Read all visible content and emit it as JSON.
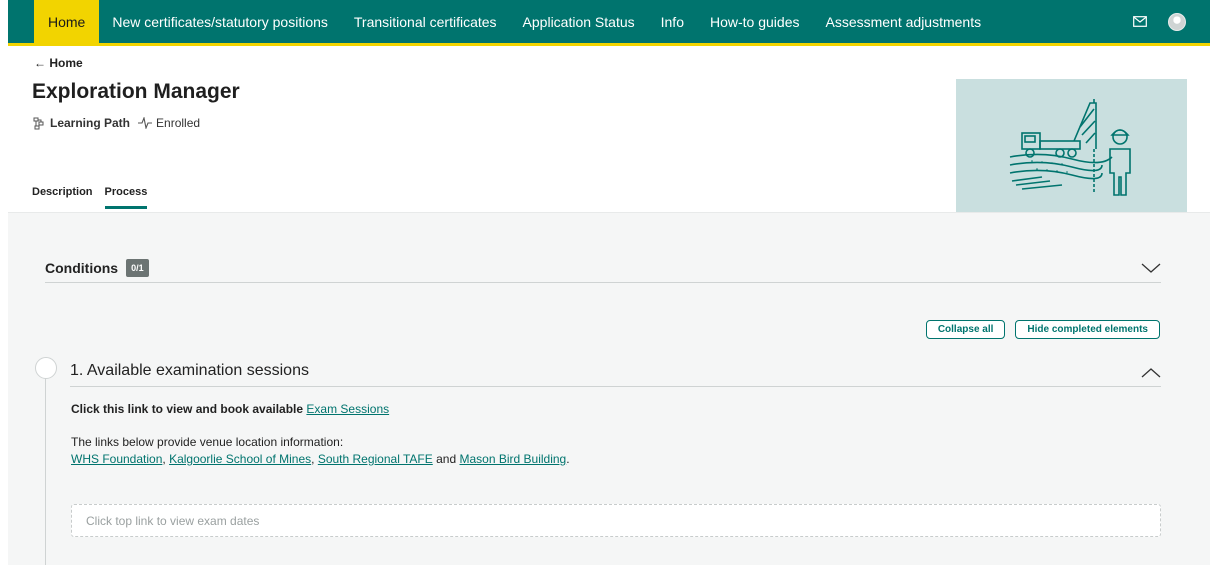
{
  "nav": {
    "items": [
      "Home",
      "New certificates/statutory positions",
      "Transitional certificates",
      "Application Status",
      "Info",
      "How-to guides",
      "Assessment adjustments"
    ]
  },
  "header": {
    "back_label": "← Home",
    "title": "Exploration Manager",
    "type_label": "Learning Path",
    "status_label": "Enrolled",
    "tabs": [
      "Description",
      "Process"
    ]
  },
  "conditions": {
    "title": "Conditions",
    "badge": "0/1"
  },
  "actions": {
    "collapse_label": "Collapse all",
    "hide_label": "Hide completed elements"
  },
  "step": {
    "title": "1. Available examination sessions",
    "link_prefix": "Click this link to view and book available",
    "link_text": "Exam Sessions",
    "intro": "The links below provide venue location information:",
    "venues": [
      "WHS Foundation",
      "Kalgoorlie School of Mines",
      "South Regional TAFE",
      "Mason Bird Building"
    ],
    "placeholder": "Click top link to view exam dates"
  },
  "colors": {
    "brand": "#00746e",
    "accent": "#f2d400"
  },
  "icons": {
    "mail": "mail-icon",
    "avatar": "avatar",
    "learning_path": "learning-path-icon",
    "status": "pulse-icon",
    "chevron_down": "chevron-down-icon",
    "chevron_up": "chevron-up-icon"
  }
}
